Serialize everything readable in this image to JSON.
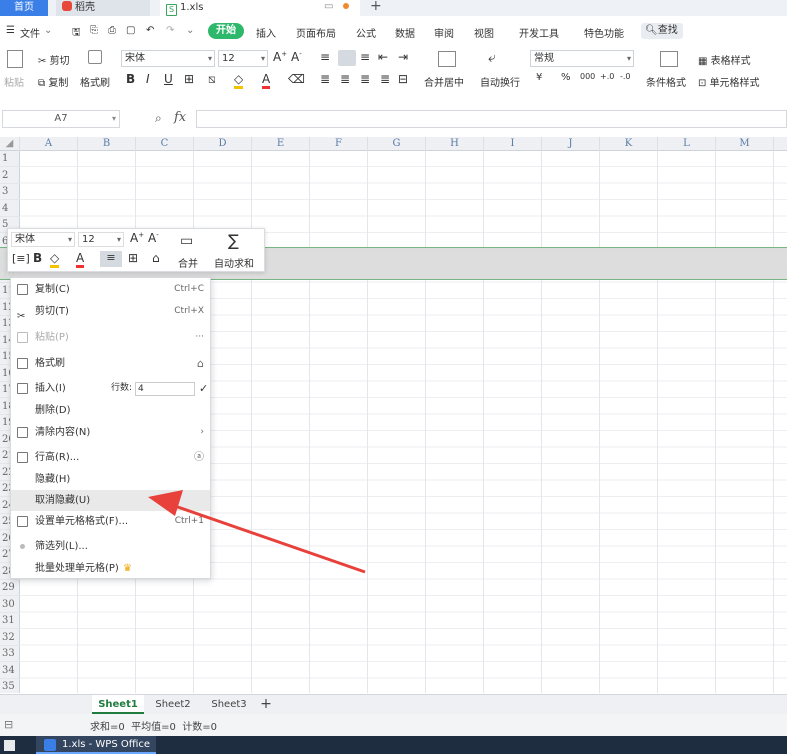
{
  "tabs": {
    "home": "首页",
    "docer": "稻壳",
    "file": "1.xls"
  },
  "menu": [
    "文件",
    "开始",
    "插入",
    "页面布局",
    "公式",
    "数据",
    "审阅",
    "视图",
    "开发工具",
    "特色功能"
  ],
  "search_label": "查找",
  "ribbon": {
    "paste": "粘贴",
    "cut": "剪切",
    "copy": "复制",
    "format_painter": "格式刷",
    "font_name": "宋体",
    "font_size": "12",
    "merge_center": "合并居中",
    "wrap_text": "自动换行",
    "number_format": "常规",
    "currency": "¥",
    "percent": "%",
    "thousands": "000",
    "cond_format": "条件格式",
    "table_style": "表格样式",
    "cell_style": "单元格样式"
  },
  "formula_bar": {
    "name_box": "A7",
    "fx": "fx"
  },
  "columns": [
    "A",
    "B",
    "C",
    "D",
    "E",
    "F",
    "G",
    "H",
    "I",
    "J",
    "K",
    "L",
    "M"
  ],
  "rows": [
    "1",
    "2",
    "3",
    "4",
    "5",
    "6",
    "7",
    "10",
    "11",
    "12",
    "13",
    "14",
    "15",
    "16",
    "17",
    "18",
    "19",
    "20",
    "21",
    "22",
    "23",
    "24",
    "25",
    "26",
    "27",
    "28",
    "29",
    "30",
    "31",
    "32",
    "33",
    "34",
    "35",
    "36"
  ],
  "mini_toolbar": {
    "font_name": "宋体",
    "font_size": "12",
    "merge": "合并",
    "autosum": "自动求和"
  },
  "context_menu": {
    "items": [
      {
        "label": "复制(C)",
        "shortcut": "Ctrl+C"
      },
      {
        "label": "剪切(T)",
        "shortcut": "Ctrl+X"
      },
      {
        "label": "粘贴(P)",
        "shortcut": "···"
      },
      {
        "label": "格式刷",
        "shortcut": ""
      },
      {
        "label": "插入(I)",
        "shortcut": ""
      },
      {
        "label": "删除(D)",
        "shortcut": ""
      },
      {
        "label": "清除内容(N)",
        "shortcut": "›"
      },
      {
        "label": "行高(R)...",
        "shortcut": ""
      },
      {
        "label": "隐藏(H)",
        "shortcut": ""
      },
      {
        "label": "取消隐藏(U)",
        "shortcut": ""
      },
      {
        "label": "设置单元格格式(F)...",
        "shortcut": "Ctrl+1"
      },
      {
        "label": "筛选列(L)...",
        "shortcut": ""
      },
      {
        "label": "批量处理单元格(P)",
        "shortcut": ""
      }
    ],
    "row_count_label": "行数:",
    "row_count_value": "4"
  },
  "sheets": [
    "Sheet1",
    "Sheet2",
    "Sheet3"
  ],
  "status": "求和=0  平均值=0  计数=0",
  "taskbar_item": "1.xls - WPS Office",
  "colors": {
    "accent_green": "#2eb86c",
    "tab_blue": "#3a7ee8",
    "arrow_red": "#e8403a"
  }
}
